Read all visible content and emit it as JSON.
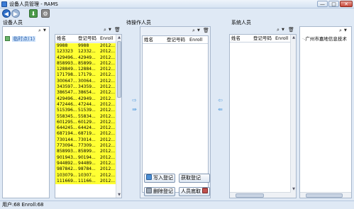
{
  "window": {
    "title": "设备人员管理 - RAMS",
    "min": "—",
    "max": "□",
    "close": "✕"
  },
  "toolbar": {
    "back_icon": "arrow-left-icon",
    "back_glyph": "◀",
    "forward_icon": "arrow-right-icon",
    "forward_glyph": "▶",
    "save_icon": "save-icon",
    "save_glyph": "⬇",
    "tool_icon": "tool-icon",
    "tool_glyph": "⚙"
  },
  "device_panel": {
    "label": "设备人员",
    "search_glyph": "⌕",
    "node_label": "临时点(1)"
  },
  "left_list": {
    "search_glyph": "⌕",
    "delete_glyph": "🗑",
    "columns": [
      "姓名",
      "登记号码",
      "Enroll"
    ],
    "rows": [
      [
        "9988",
        "9988",
        "2012..."
      ],
      [
        "123323",
        "12332...",
        "2012..."
      ],
      [
        "429496...",
        "42949...",
        "2012..."
      ],
      [
        "858993...",
        "85899...",
        "2012..."
      ],
      [
        "128849...",
        "12884...",
        "2012..."
      ],
      [
        "171798...",
        "17179...",
        "2012..."
      ],
      [
        "300647...",
        "30064...",
        "2012..."
      ],
      [
        "343597...",
        "34359...",
        "2012..."
      ],
      [
        "386547...",
        "38654...",
        "2012..."
      ],
      [
        "429496...",
        "42949...",
        "2012..."
      ],
      [
        "472446...",
        "47244...",
        "2012..."
      ],
      [
        "515396...",
        "51539...",
        "2012..."
      ],
      [
        "558345...",
        "55834...",
        "2012..."
      ],
      [
        "601295...",
        "60129...",
        "2012..."
      ],
      [
        "644245...",
        "64424...",
        "2012..."
      ],
      [
        "687194...",
        "68719...",
        "2012..."
      ],
      [
        "730144...",
        "73014...",
        "2012..."
      ],
      [
        "773094...",
        "77309...",
        "2012..."
      ],
      [
        "858993...",
        "85899...",
        "2012..."
      ],
      [
        "901943...",
        "90194...",
        "2012..."
      ],
      [
        "944892...",
        "94489...",
        "2012..."
      ],
      [
        "987842...",
        "98784...",
        "2012..."
      ],
      [
        "103079...",
        "10307...",
        "2012..."
      ],
      [
        "111669...",
        "11166...",
        "2012..."
      ]
    ]
  },
  "pending": {
    "label": "待操作人员",
    "search_glyph": "⌕",
    "delete_glyph": "🗑",
    "columns": [
      "姓名",
      "登记号码",
      "Enroll"
    ],
    "buttons": {
      "write": "写入登记",
      "fetch": "获取登记",
      "delete": "删除登记",
      "face": "人员底取"
    }
  },
  "system": {
    "label": "系统人员",
    "search_glyph": "⌕",
    "delete_glyph": "🗑",
    "columns": [
      "姓名",
      "登记号码",
      "Enroll"
    ]
  },
  "org": {
    "search_glyph": "⌕",
    "node_label": "广州市嘉地信息技术"
  },
  "arrows": {
    "right": "⇨",
    "right_all": "⇛",
    "left": "⇦",
    "left_all": "⇚"
  },
  "status": {
    "text": "用户:68 Enroll:68"
  }
}
